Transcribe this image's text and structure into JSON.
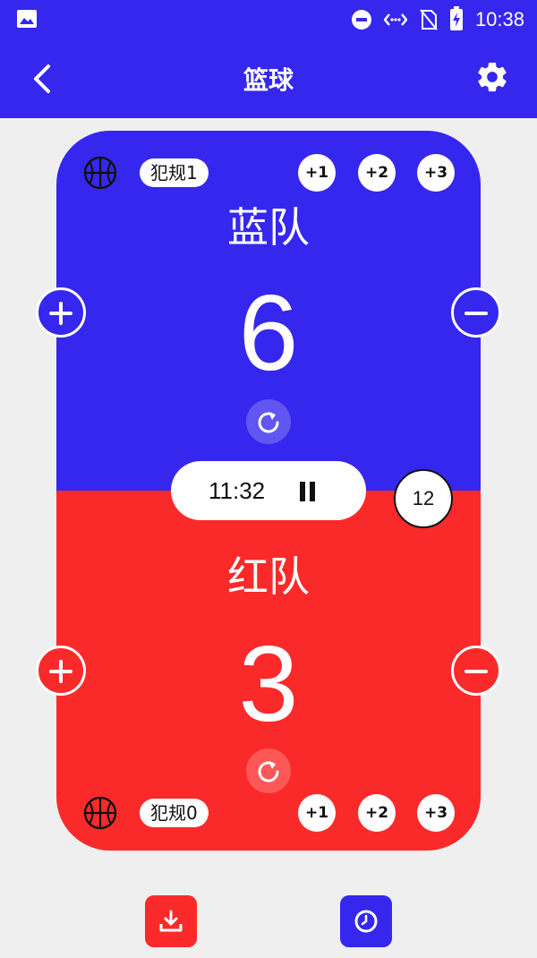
{
  "status": {
    "time": "10:38"
  },
  "appbar": {
    "title": "篮球"
  },
  "blue": {
    "name": "蓝队",
    "score": "6",
    "foul": "犯规1",
    "adds": [
      "+1",
      "+2",
      "+3"
    ],
    "color": "#3527ee"
  },
  "red": {
    "name": "红队",
    "score": "3",
    "foul": "犯规0",
    "adds": [
      "+1",
      "+2",
      "+3"
    ],
    "color": "#fb2a2a"
  },
  "timer": {
    "time": "11:32"
  },
  "period": "12"
}
